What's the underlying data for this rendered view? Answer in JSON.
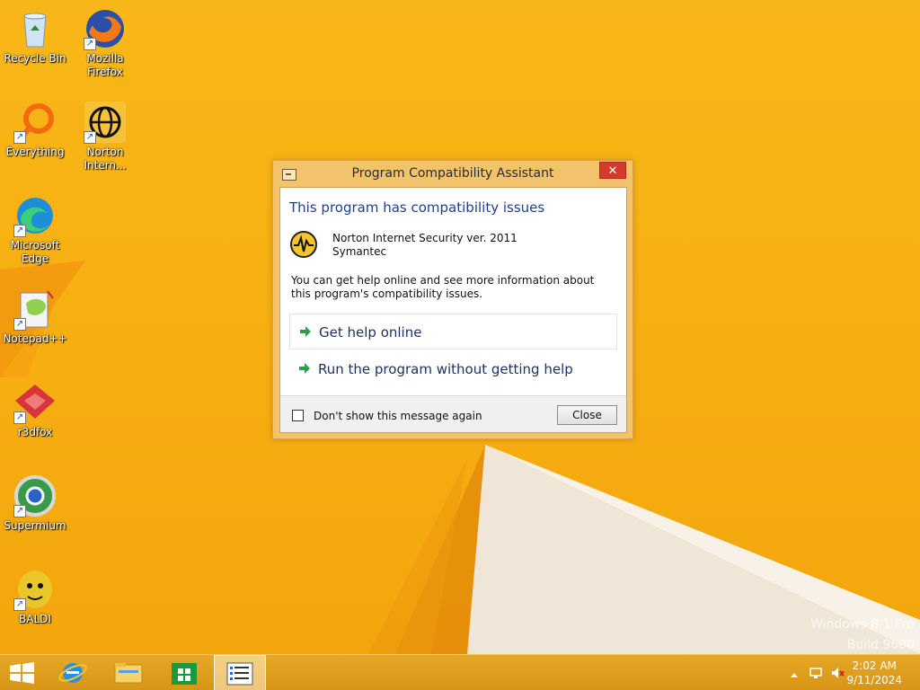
{
  "desktop": {
    "icons": [
      {
        "label": "Recycle Bin",
        "icon": "recycle-bin-icon"
      },
      {
        "label": "Mozilla Firefox",
        "icon": "firefox-icon"
      },
      {
        "label": "Everything",
        "icon": "everything-icon"
      },
      {
        "label": "Norton Intern...",
        "icon": "norton-icon"
      },
      {
        "label": "Microsoft Edge",
        "icon": "edge-icon"
      },
      {
        "label": "Notepad++",
        "icon": "notepadpp-icon"
      },
      {
        "label": "r3dfox",
        "icon": "r3dfox-icon"
      },
      {
        "label": "Supermium",
        "icon": "supermium-icon"
      },
      {
        "label": "BALDI",
        "icon": "baldi-icon"
      }
    ],
    "watermark": {
      "line1": "Windows 8.1 Pro",
      "line2": "Build 9600"
    }
  },
  "dialog": {
    "title": "Program Compatibility Assistant",
    "close_glyph": "✕",
    "heading": "This program has compatibility issues",
    "program_name": "Norton Internet Security ver. 2011",
    "publisher": "Symantec",
    "info_text": "You can get help online and see more information about this program's compatibility issues.",
    "options": [
      {
        "label": "Get help online"
      },
      {
        "label": "Run the program without getting help"
      }
    ],
    "checkbox_label": "Don't show this message again",
    "close_button": "Close"
  },
  "taskbar": {
    "buttons": [
      "start-icon",
      "internet-explorer-icon",
      "file-explorer-icon",
      "store-icon",
      "notepad-icon"
    ],
    "clock": {
      "time": "2:02 AM",
      "date": "9/11/2024"
    }
  },
  "colors": {
    "accent": "#f7b012",
    "heading": "#1f3f8f",
    "close_red": "#d63a2b"
  }
}
